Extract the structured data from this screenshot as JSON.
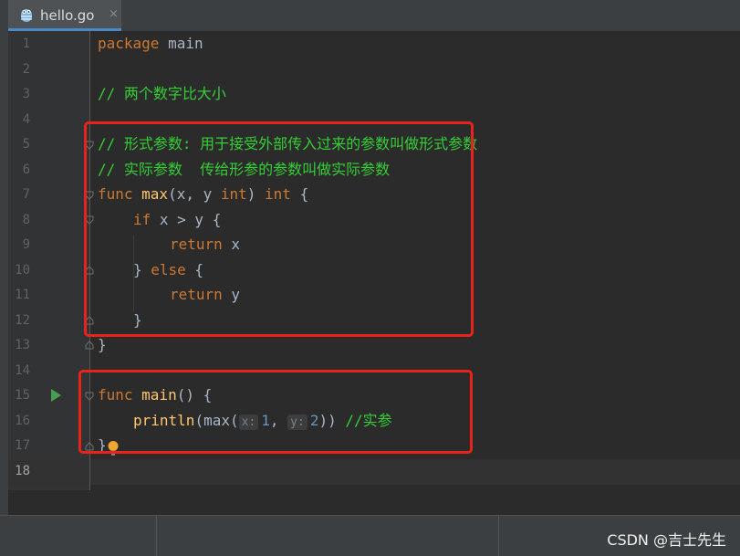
{
  "tab": {
    "filename": "hello.go",
    "close": "×"
  },
  "lines": {
    "1": {
      "kw": "package",
      "rest": " main"
    },
    "3": {
      "comment": "// 两个数字比大小"
    },
    "5": {
      "comment": "// 形式参数: 用于接受外部传入过来的参数叫做形式参数"
    },
    "6": {
      "comment": "// 实际参数  传给形参的参数叫做实际参数"
    },
    "7": {
      "kw": "func",
      "name": " max",
      "p1": "(x, y ",
      "t1": "int",
      "p2": ") ",
      "t2": "int",
      "p3": " {"
    },
    "8": {
      "kw": "if",
      "rest": " x > y {"
    },
    "9": {
      "kw": "return",
      "rest": " x"
    },
    "10": {
      "p1": "} ",
      "kw": "else",
      "p2": " {"
    },
    "11": {
      "kw": "return",
      "rest": " y"
    },
    "12": {
      "text": "}"
    },
    "13": {
      "text": "}"
    },
    "15": {
      "kw": "func",
      "name": " main",
      "rest": "() {"
    },
    "16": {
      "call": "println",
      "p1": "(max(",
      "hint_x": "x:",
      "arg1": "1",
      "comma": ", ",
      "hint_y": "y:",
      "arg2": "2",
      "p2": ")) ",
      "comment": "//实参"
    },
    "17": {
      "text": "}"
    }
  },
  "line_numbers": [
    "1",
    "2",
    "3",
    "4",
    "5",
    "6",
    "7",
    "8",
    "9",
    "10",
    "11",
    "12",
    "13",
    "14",
    "15",
    "16",
    "17",
    "18"
  ],
  "watermark": "CSDN @吉士先生",
  "colors": {
    "keyword": "#cc7832",
    "function": "#ffc66d",
    "comment": "#36ce36",
    "number": "#6897bb",
    "highlight_box": "#e8231b"
  }
}
